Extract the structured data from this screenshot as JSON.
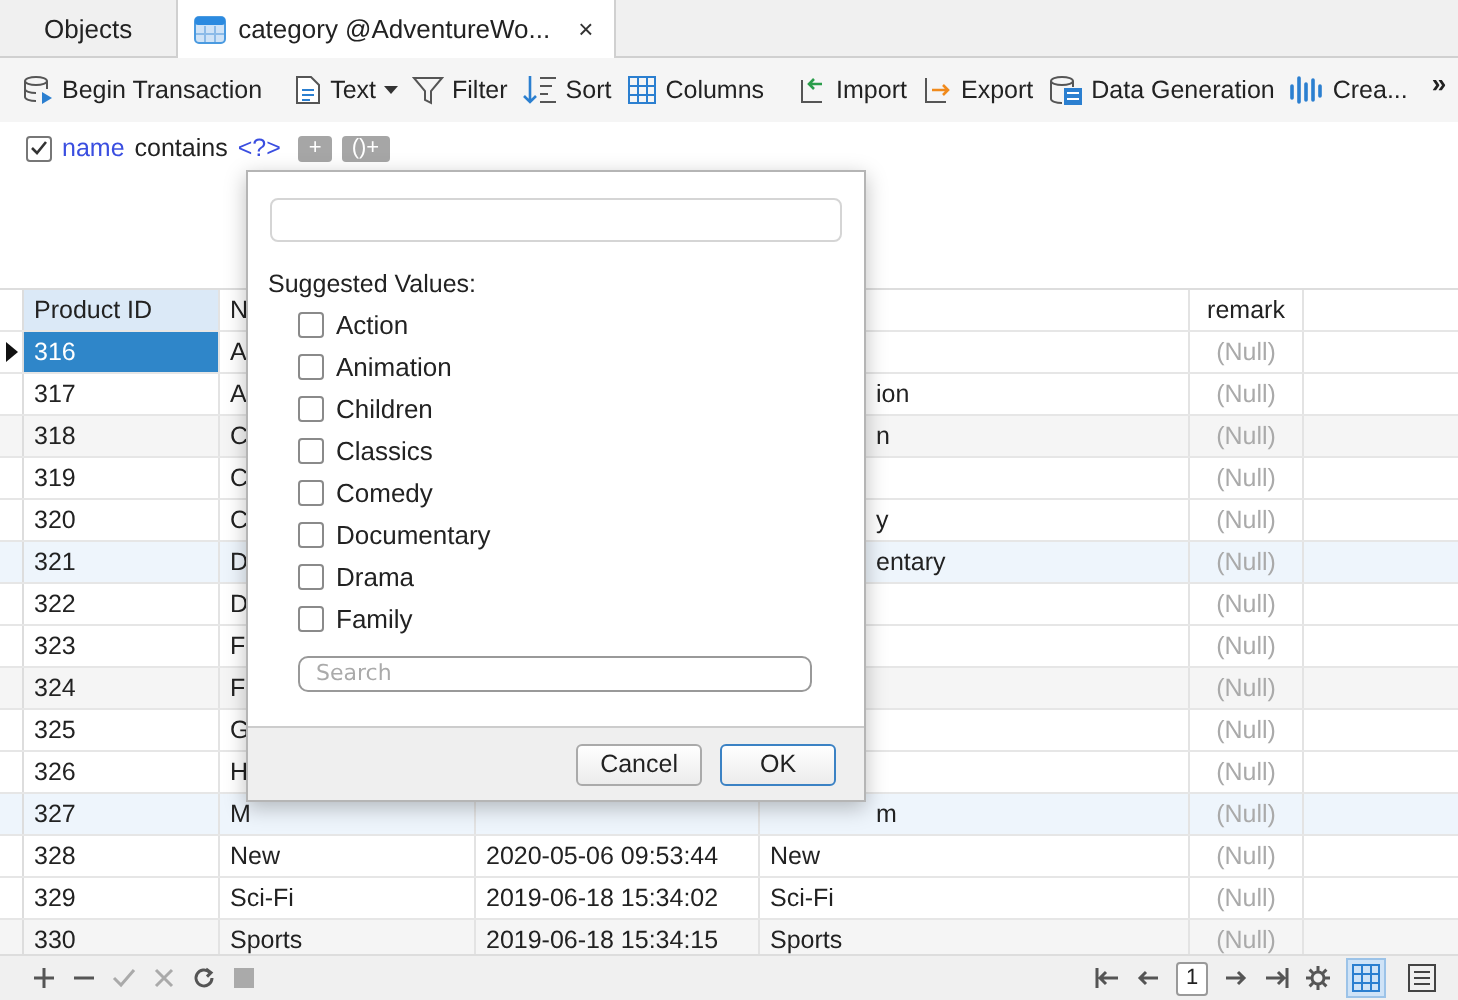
{
  "tabs": [
    {
      "label": "Objects",
      "selected": false
    },
    {
      "label": "category @AdventureWo...",
      "selected": true,
      "close": "×"
    }
  ],
  "toolbar": [
    {
      "kind": "button",
      "label": "Begin Transaction",
      "dropdown": false
    },
    {
      "kind": "separator"
    },
    {
      "kind": "button",
      "label": "Text",
      "dropdown": true
    },
    {
      "kind": "button",
      "label": "Filter",
      "dropdown": false
    },
    {
      "kind": "button",
      "label": "Sort",
      "dropdown": false
    },
    {
      "kind": "button",
      "label": "Columns",
      "dropdown": false
    },
    {
      "kind": "separator"
    },
    {
      "kind": "button",
      "label": "Import",
      "dropdown": false
    },
    {
      "kind": "button",
      "label": "Export",
      "dropdown": false
    },
    {
      "kind": "button",
      "label": "Data Generation",
      "dropdown": false
    },
    {
      "kind": "button",
      "label": "Crea...",
      "dropdown": false
    },
    {
      "kind": "overflow",
      "label": "»"
    }
  ],
  "filter": {
    "enabled": true,
    "field": "name",
    "operator": "contains",
    "value": "<?>",
    "add_button": "+",
    "group_button": "()+"
  },
  "grid": {
    "columns": [
      {
        "label": "Product ID"
      },
      {
        "label": "N"
      },
      {},
      {},
      {
        "label": "remark"
      }
    ],
    "rows": [
      {
        "selected": true,
        "highlighted": false,
        "product_id": "316",
        "column_2": "A",
        "remark": "(Null)"
      },
      {
        "selected": false,
        "highlighted": false,
        "product_id": "317",
        "column_2": "A",
        "column_4": "ion",
        "remark": "(Null)"
      },
      {
        "selected": false,
        "highlighted": false,
        "product_id": "318",
        "column_2": "C",
        "column_4": "n",
        "remark": "(Null)"
      },
      {
        "selected": false,
        "highlighted": false,
        "product_id": "319",
        "column_2": "C",
        "remark": "(Null)"
      },
      {
        "selected": false,
        "highlighted": false,
        "product_id": "320",
        "column_2": "C",
        "column_4": "y",
        "remark": "(Null)"
      },
      {
        "selected": false,
        "highlighted": true,
        "product_id": "321",
        "column_2": "D",
        "column_4": "entary",
        "remark": "(Null)"
      },
      {
        "selected": false,
        "highlighted": false,
        "product_id": "322",
        "column_2": "D",
        "remark": "(Null)"
      },
      {
        "selected": false,
        "highlighted": false,
        "product_id": "323",
        "column_2": "F",
        "remark": "(Null)"
      },
      {
        "selected": false,
        "highlighted": false,
        "product_id": "324",
        "column_2": "F",
        "remark": "(Null)"
      },
      {
        "selected": false,
        "highlighted": false,
        "product_id": "325",
        "column_2": "G",
        "remark": "(Null)"
      },
      {
        "selected": false,
        "highlighted": false,
        "product_id": "326",
        "column_2": "H",
        "remark": "(Null)"
      },
      {
        "selected": false,
        "highlighted": true,
        "product_id": "327",
        "column_2": "M",
        "column_4": "m",
        "remark": "(Null)"
      },
      {
        "selected": false,
        "highlighted": false,
        "product_id": "328",
        "column_2": "New",
        "column_3": "2020-05-06 09:53:44",
        "column_4": "New",
        "remark": "(Null)"
      },
      {
        "selected": false,
        "highlighted": false,
        "product_id": "329",
        "column_2": "Sci-Fi",
        "column_3": "2019-06-18 15:34:02",
        "column_4": "Sci-Fi",
        "remark": "(Null)"
      },
      {
        "selected": false,
        "highlighted": false,
        "product_id": "330",
        "column_2": "Sports",
        "column_3": "2019-06-18 15:34:15",
        "column_4": "Sports",
        "remark": "(Null)"
      }
    ]
  },
  "popup": {
    "heading": "Suggested Values:",
    "values": [
      {
        "label": "Action",
        "checked": false
      },
      {
        "label": "Animation",
        "checked": false
      },
      {
        "label": "Children",
        "checked": false
      },
      {
        "label": "Classics",
        "checked": false
      },
      {
        "label": "Comedy",
        "checked": false
      },
      {
        "label": "Documentary",
        "checked": false
      },
      {
        "label": "Drama",
        "checked": false
      },
      {
        "label": "Family",
        "checked": false
      }
    ],
    "search": {
      "placeholder": "Search"
    },
    "buttons": [
      {
        "label": "Cancel",
        "default": false
      },
      {
        "label": "OK",
        "default": true
      }
    ]
  },
  "status_bar": {
    "page": "1",
    "views": [
      {
        "selected": true
      },
      {
        "selected": false
      }
    ]
  }
}
